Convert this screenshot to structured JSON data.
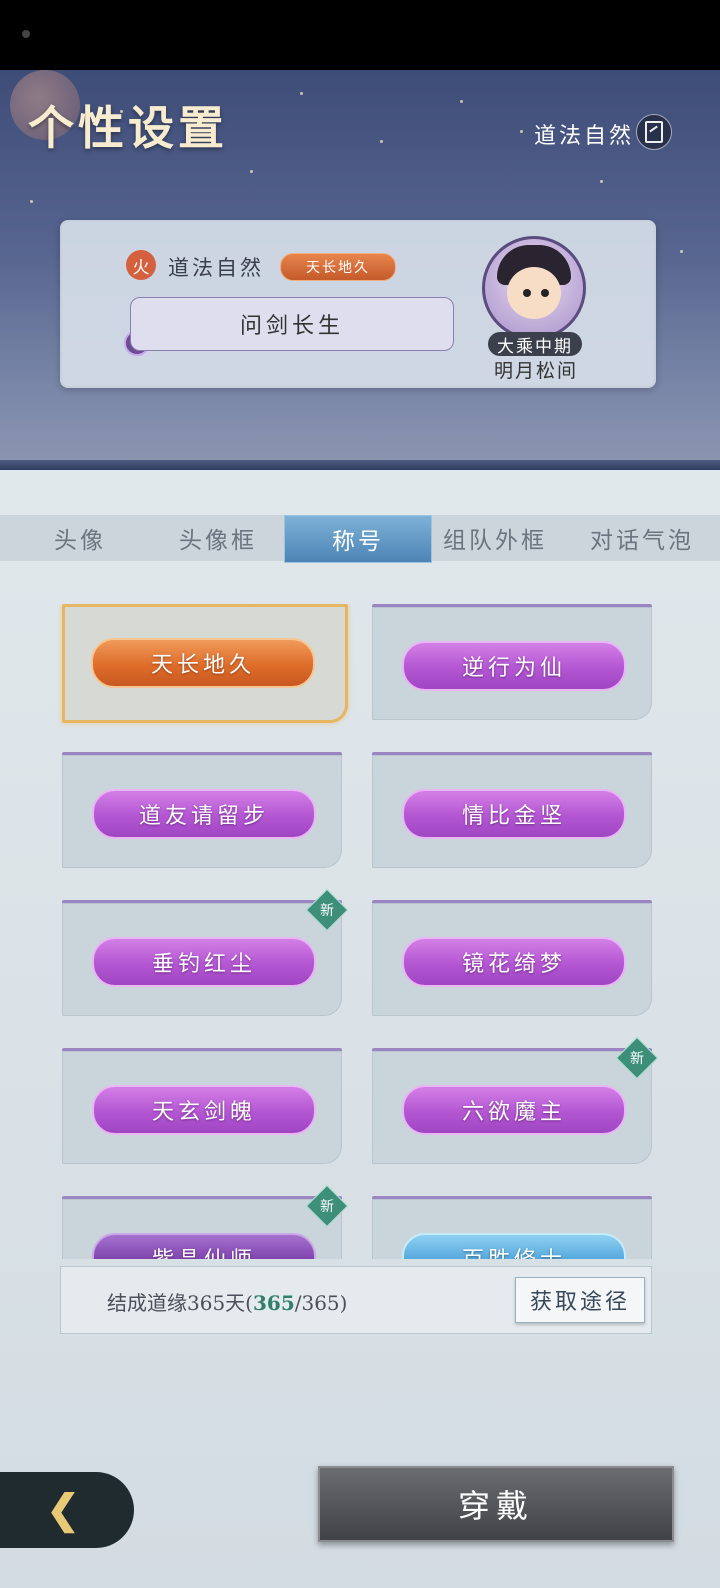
{
  "header": {
    "page_title": "个性设置",
    "player_name_top": "道法自然"
  },
  "preview": {
    "element": "火",
    "player_name": "道法自然",
    "equipped_title": "天长地久",
    "bubble_text": "问剑长生",
    "realm": "大乘中期",
    "nickname": "明月松间"
  },
  "tabs": [
    {
      "label": "头像",
      "active": false
    },
    {
      "label": "头像框",
      "active": false
    },
    {
      "label": "称号",
      "active": true
    },
    {
      "label": "组队外框",
      "active": false
    },
    {
      "label": "对话气泡",
      "active": false
    }
  ],
  "titles": [
    {
      "label": "天长地久",
      "style": "orange",
      "selected": true,
      "new": false
    },
    {
      "label": "逆行为仙",
      "style": "purple",
      "selected": false,
      "new": false
    },
    {
      "label": "道友请留步",
      "style": "purple",
      "selected": false,
      "new": false
    },
    {
      "label": "情比金坚",
      "style": "purple",
      "selected": false,
      "new": false
    },
    {
      "label": "垂钓红尘",
      "style": "purple",
      "selected": false,
      "new": true
    },
    {
      "label": "镜花绮梦",
      "style": "purple",
      "selected": false,
      "new": false
    },
    {
      "label": "天玄剑魄",
      "style": "purple",
      "selected": false,
      "new": false
    },
    {
      "label": "六欲魔主",
      "style": "purple",
      "selected": false,
      "new": true
    },
    {
      "label": "紫晶仙师",
      "style": "dark",
      "selected": false,
      "new": true
    },
    {
      "label": "百胜修士",
      "style": "blue",
      "selected": false,
      "new": false
    }
  ],
  "new_badge": "新",
  "source": {
    "text_prefix": "结成道缘365天(",
    "current": "365",
    "text_suffix": "/365)",
    "button": "获取途径"
  },
  "footer": {
    "wear_button": "穿戴"
  }
}
